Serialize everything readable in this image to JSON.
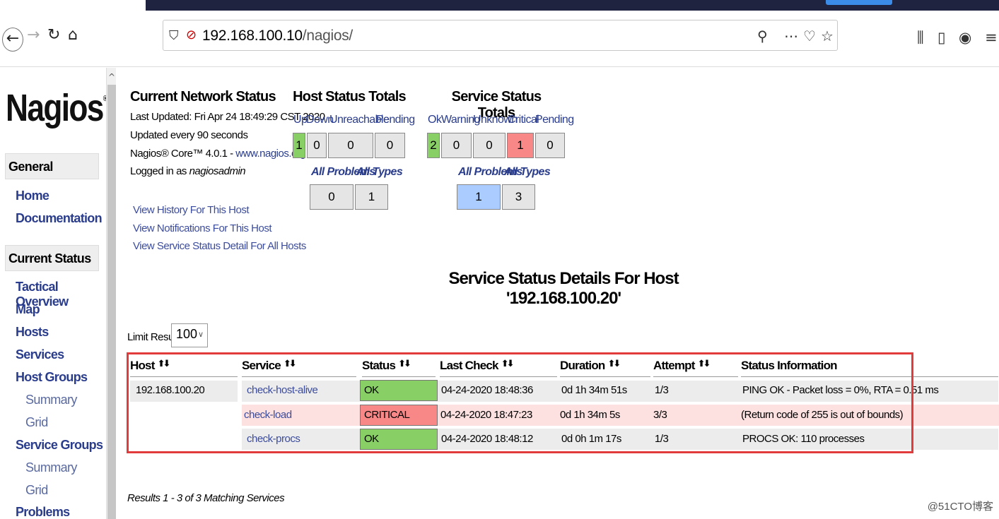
{
  "browser": {
    "url_host": "192.168.100.10",
    "url_path": "/nagios/"
  },
  "sidebar": {
    "logo": "Nagios",
    "logo_mark": "®",
    "general_header": "General",
    "general_links": [
      "Home",
      "Documentation"
    ],
    "current_status_header": "Current Status",
    "status_links": {
      "tactical": "Tactical Overview",
      "map": "Map",
      "hosts": "Hosts",
      "services": "Services",
      "host_groups": "Host Groups",
      "hg_summary": "Summary",
      "hg_grid": "Grid",
      "service_groups": "Service Groups",
      "sg_summary": "Summary",
      "sg_grid": "Grid",
      "problems": "Problems"
    }
  },
  "info": {
    "title": "Current Network Status",
    "last_updated": "Last Updated: Fri Apr 24 18:49:29 CST 2020",
    "update_interval": "Updated every 90 seconds",
    "version_prefix": "Nagios® Core™ 4.0.1 - ",
    "version_link": "www.nagios.org",
    "logged_prefix": "Logged in as ",
    "logged_user": "nagiosadmin",
    "links": [
      "View History For This Host",
      "View Notifications For This Host",
      "View Service Status Detail For All Hosts"
    ]
  },
  "host_totals": {
    "title": "Host Status Totals",
    "labels": {
      "up": "Up",
      "down": "Down",
      "unreachable": "Unreachable",
      "pending": "Pending"
    },
    "values": {
      "up": "1",
      "down": "0",
      "unreachable": "0",
      "pending": "0"
    },
    "sub_labels": {
      "all_problems": "All Problems",
      "all_types": "All Types"
    },
    "sub_values": {
      "all_problems": "0",
      "all_types": "1"
    }
  },
  "service_totals": {
    "title": "Service Status Totals",
    "labels": {
      "ok": "Ok",
      "warning": "Warning",
      "unknown": "Unknown",
      "critical": "Critical",
      "pending": "Pending"
    },
    "values": {
      "ok": "2",
      "warning": "0",
      "unknown": "0",
      "critical": "1",
      "pending": "0"
    },
    "sub_labels": {
      "all_problems": "All Problems",
      "all_types": "All Types"
    },
    "sub_values": {
      "all_problems": "1",
      "all_types": "3"
    }
  },
  "page_title": "Service Status Details For Host '192.168.100.20'",
  "limit": {
    "label": "Limit Results:",
    "value": "100"
  },
  "table": {
    "headers": [
      "Host",
      "Service",
      "Status",
      "Last Check",
      "Duration",
      "Attempt",
      "Status Information"
    ],
    "host": "192.168.100.20",
    "rows": [
      {
        "service": "check-host-alive",
        "status": "OK",
        "last_check": "04-24-2020 18:48:36",
        "duration": "0d 1h 34m 51s",
        "attempt": "1/3",
        "info": "PING OK - Packet loss = 0%, RTA = 0.51 ms"
      },
      {
        "service": "check-load",
        "status": "CRITICAL",
        "last_check": "04-24-2020 18:47:23",
        "duration": "0d 1h 34m 5s",
        "attempt": "3/3",
        "info": "(Return code of 255 is out of bounds)"
      },
      {
        "service": "check-procs",
        "status": "OK",
        "last_check": "04-24-2020 18:48:12",
        "duration": "0d 0h 1m 17s",
        "attempt": "1/3",
        "info": "PROCS OK: 110 processes"
      }
    ]
  },
  "results_text": "Results 1 - 3 of 3 Matching Services",
  "watermark": "@51CTO博客",
  "colors": {
    "ok": "#88d066",
    "critical": "#f88888",
    "highlight": "#aaccff",
    "frame": "#e23b3b"
  }
}
